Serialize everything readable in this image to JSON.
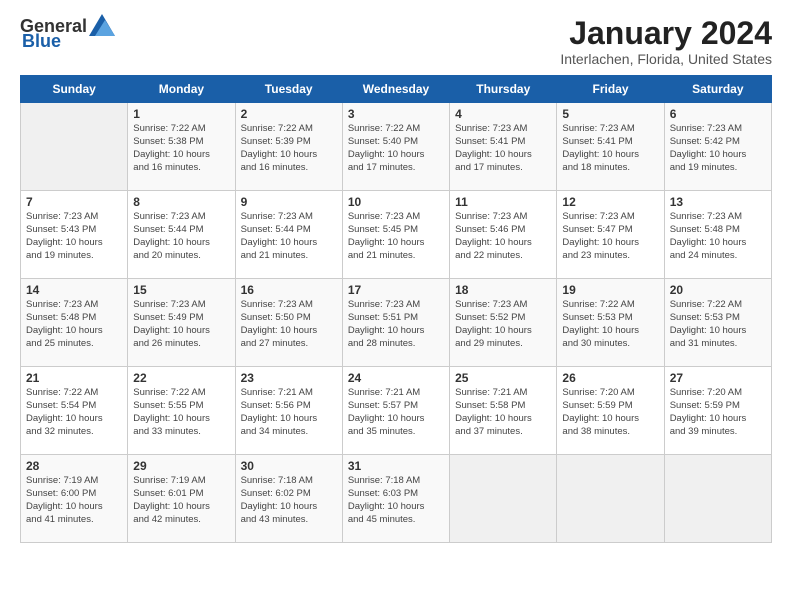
{
  "app": {
    "logo_general": "General",
    "logo_blue": "Blue"
  },
  "header": {
    "title": "January 2024",
    "subtitle": "Interlachen, Florida, United States"
  },
  "weekdays": [
    "Sunday",
    "Monday",
    "Tuesday",
    "Wednesday",
    "Thursday",
    "Friday",
    "Saturday"
  ],
  "weeks": [
    [
      {
        "day": "",
        "info": ""
      },
      {
        "day": "1",
        "info": "Sunrise: 7:22 AM\nSunset: 5:38 PM\nDaylight: 10 hours\nand 16 minutes."
      },
      {
        "day": "2",
        "info": "Sunrise: 7:22 AM\nSunset: 5:39 PM\nDaylight: 10 hours\nand 16 minutes."
      },
      {
        "day": "3",
        "info": "Sunrise: 7:22 AM\nSunset: 5:40 PM\nDaylight: 10 hours\nand 17 minutes."
      },
      {
        "day": "4",
        "info": "Sunrise: 7:23 AM\nSunset: 5:41 PM\nDaylight: 10 hours\nand 17 minutes."
      },
      {
        "day": "5",
        "info": "Sunrise: 7:23 AM\nSunset: 5:41 PM\nDaylight: 10 hours\nand 18 minutes."
      },
      {
        "day": "6",
        "info": "Sunrise: 7:23 AM\nSunset: 5:42 PM\nDaylight: 10 hours\nand 19 minutes."
      }
    ],
    [
      {
        "day": "7",
        "info": "Sunrise: 7:23 AM\nSunset: 5:43 PM\nDaylight: 10 hours\nand 19 minutes."
      },
      {
        "day": "8",
        "info": "Sunrise: 7:23 AM\nSunset: 5:44 PM\nDaylight: 10 hours\nand 20 minutes."
      },
      {
        "day": "9",
        "info": "Sunrise: 7:23 AM\nSunset: 5:44 PM\nDaylight: 10 hours\nand 21 minutes."
      },
      {
        "day": "10",
        "info": "Sunrise: 7:23 AM\nSunset: 5:45 PM\nDaylight: 10 hours\nand 21 minutes."
      },
      {
        "day": "11",
        "info": "Sunrise: 7:23 AM\nSunset: 5:46 PM\nDaylight: 10 hours\nand 22 minutes."
      },
      {
        "day": "12",
        "info": "Sunrise: 7:23 AM\nSunset: 5:47 PM\nDaylight: 10 hours\nand 23 minutes."
      },
      {
        "day": "13",
        "info": "Sunrise: 7:23 AM\nSunset: 5:48 PM\nDaylight: 10 hours\nand 24 minutes."
      }
    ],
    [
      {
        "day": "14",
        "info": "Sunrise: 7:23 AM\nSunset: 5:48 PM\nDaylight: 10 hours\nand 25 minutes."
      },
      {
        "day": "15",
        "info": "Sunrise: 7:23 AM\nSunset: 5:49 PM\nDaylight: 10 hours\nand 26 minutes."
      },
      {
        "day": "16",
        "info": "Sunrise: 7:23 AM\nSunset: 5:50 PM\nDaylight: 10 hours\nand 27 minutes."
      },
      {
        "day": "17",
        "info": "Sunrise: 7:23 AM\nSunset: 5:51 PM\nDaylight: 10 hours\nand 28 minutes."
      },
      {
        "day": "18",
        "info": "Sunrise: 7:23 AM\nSunset: 5:52 PM\nDaylight: 10 hours\nand 29 minutes."
      },
      {
        "day": "19",
        "info": "Sunrise: 7:22 AM\nSunset: 5:53 PM\nDaylight: 10 hours\nand 30 minutes."
      },
      {
        "day": "20",
        "info": "Sunrise: 7:22 AM\nSunset: 5:53 PM\nDaylight: 10 hours\nand 31 minutes."
      }
    ],
    [
      {
        "day": "21",
        "info": "Sunrise: 7:22 AM\nSunset: 5:54 PM\nDaylight: 10 hours\nand 32 minutes."
      },
      {
        "day": "22",
        "info": "Sunrise: 7:22 AM\nSunset: 5:55 PM\nDaylight: 10 hours\nand 33 minutes."
      },
      {
        "day": "23",
        "info": "Sunrise: 7:21 AM\nSunset: 5:56 PM\nDaylight: 10 hours\nand 34 minutes."
      },
      {
        "day": "24",
        "info": "Sunrise: 7:21 AM\nSunset: 5:57 PM\nDaylight: 10 hours\nand 35 minutes."
      },
      {
        "day": "25",
        "info": "Sunrise: 7:21 AM\nSunset: 5:58 PM\nDaylight: 10 hours\nand 37 minutes."
      },
      {
        "day": "26",
        "info": "Sunrise: 7:20 AM\nSunset: 5:59 PM\nDaylight: 10 hours\nand 38 minutes."
      },
      {
        "day": "27",
        "info": "Sunrise: 7:20 AM\nSunset: 5:59 PM\nDaylight: 10 hours\nand 39 minutes."
      }
    ],
    [
      {
        "day": "28",
        "info": "Sunrise: 7:19 AM\nSunset: 6:00 PM\nDaylight: 10 hours\nand 41 minutes."
      },
      {
        "day": "29",
        "info": "Sunrise: 7:19 AM\nSunset: 6:01 PM\nDaylight: 10 hours\nand 42 minutes."
      },
      {
        "day": "30",
        "info": "Sunrise: 7:18 AM\nSunset: 6:02 PM\nDaylight: 10 hours\nand 43 minutes."
      },
      {
        "day": "31",
        "info": "Sunrise: 7:18 AM\nSunset: 6:03 PM\nDaylight: 10 hours\nand 45 minutes."
      },
      {
        "day": "",
        "info": ""
      },
      {
        "day": "",
        "info": ""
      },
      {
        "day": "",
        "info": ""
      }
    ]
  ]
}
